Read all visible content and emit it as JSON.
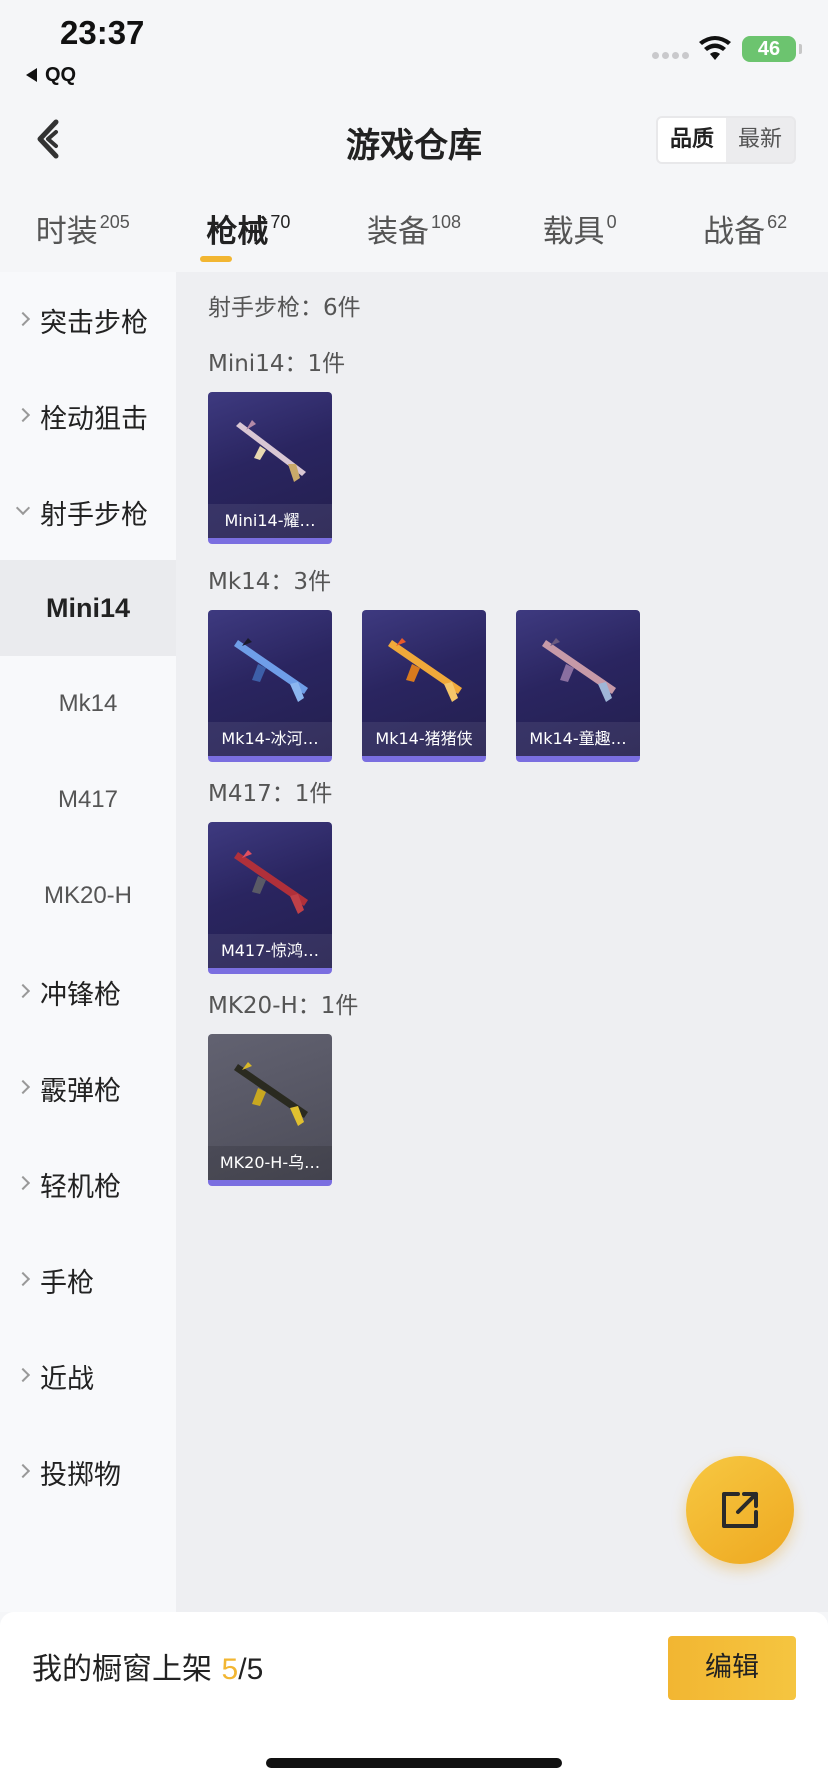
{
  "status_bar": {
    "time": "23:37",
    "back_app": "QQ",
    "battery": "46"
  },
  "header": {
    "title": "游戏仓库",
    "sort_options": [
      "品质",
      "最新"
    ],
    "sort_active": "品质"
  },
  "tabs": [
    {
      "label": "时装",
      "count": "205"
    },
    {
      "label": "枪械",
      "count": "70",
      "active": true
    },
    {
      "label": "装备",
      "count": "108"
    },
    {
      "label": "载具",
      "count": "0"
    },
    {
      "label": "战备",
      "count": "62"
    }
  ],
  "sidebar": {
    "items": [
      {
        "label": "突击步枪"
      },
      {
        "label": "栓动狙击"
      },
      {
        "label": "射手步枪",
        "expanded": true
      }
    ],
    "sub_items": [
      "Mini14",
      "Mk14",
      "M417",
      "MK20-H"
    ],
    "sub_active": "Mini14",
    "items_after": [
      "冲锋枪",
      "霰弹枪",
      "轻机枪",
      "手枪",
      "近战",
      "投掷物"
    ]
  },
  "content": {
    "category_summary": "射手步枪：6件",
    "groups": [
      {
        "title": "Mini14：1件",
        "cards": [
          {
            "name": "Mini14-耀…",
            "tone": "purple",
            "icon": "rifle-icon"
          }
        ]
      },
      {
        "title": "Mk14：3件",
        "cards": [
          {
            "name": "Mk14-冰河…",
            "tone": "purple",
            "icon": "rifle-icon"
          },
          {
            "name": "Mk14-猪猪侠",
            "tone": "purple",
            "icon": "rifle-icon"
          },
          {
            "name": "Mk14-童趣…",
            "tone": "purple",
            "icon": "rifle-icon"
          }
        ]
      },
      {
        "title": "M417：1件",
        "cards": [
          {
            "name": "M417-惊鸿…",
            "tone": "purple",
            "icon": "rifle-icon"
          }
        ]
      },
      {
        "title": "MK20-H：1件",
        "cards": [
          {
            "name": "MK20-H-乌…",
            "tone": "gray",
            "icon": "rifle-icon"
          }
        ]
      }
    ]
  },
  "fab": {
    "icon": "share-icon"
  },
  "bottom_bar": {
    "label": "我的橱窗上架",
    "count": "5",
    "total": "/5",
    "edit_label": "编辑"
  },
  "colors": {
    "accent": "#f2b632",
    "card_purple": "#2a2560",
    "card_gray": "#4c4c58",
    "card_border": "#7a6ee0"
  }
}
